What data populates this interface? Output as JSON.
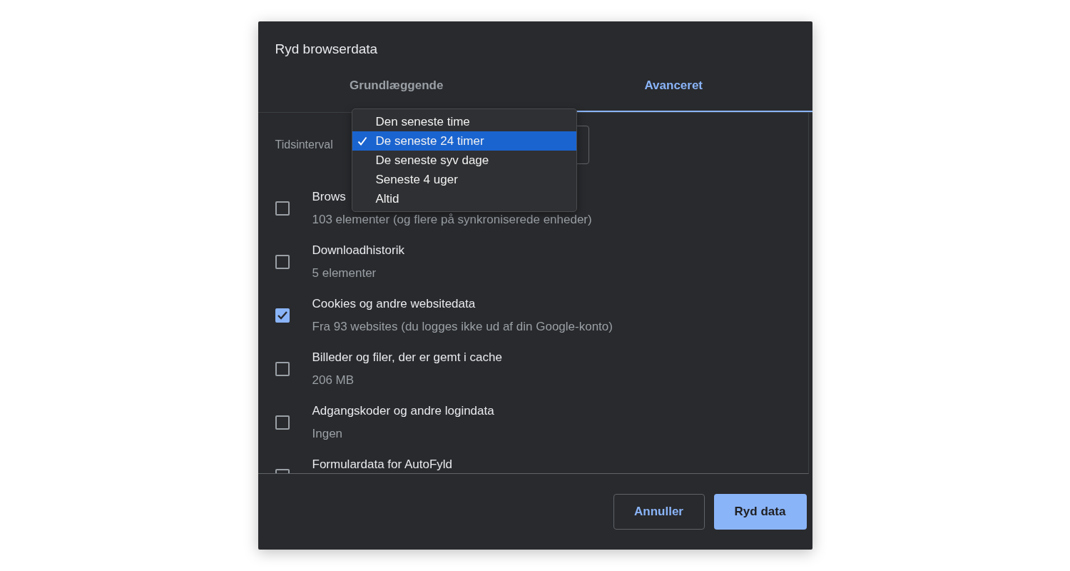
{
  "dialog": {
    "title": "Ryd browserdata",
    "tabs": [
      {
        "label": "Grundlæggende",
        "selected": false
      },
      {
        "label": "Avanceret",
        "selected": true
      }
    ],
    "time_range": {
      "label": "Tidsinterval",
      "menu": [
        {
          "label": "Den seneste time",
          "selected": false
        },
        {
          "label": "De seneste 24 timer",
          "selected": true
        },
        {
          "label": "De seneste syv dage",
          "selected": false
        },
        {
          "label": "Seneste 4 uger",
          "selected": false
        },
        {
          "label": "Altid",
          "selected": false
        }
      ]
    },
    "items": [
      {
        "title": "Brows",
        "detail": "103 elementer (og flere på synkroniserede enheder)",
        "checked": false
      },
      {
        "title": "Downloadhistorik",
        "detail": "5 elementer",
        "checked": false
      },
      {
        "title": "Cookies og andre websitedata",
        "detail": "Fra 93 websites (du logges ikke ud af din Google-konto)",
        "checked": true
      },
      {
        "title": "Billeder og filer, der er gemt i cache",
        "detail": "206 MB",
        "checked": false
      },
      {
        "title": "Adgangskoder og andre logindata",
        "detail": "Ingen",
        "checked": false
      },
      {
        "title": "Formulardata for AutoFyld",
        "checked": false
      }
    ],
    "buttons": [
      {
        "label": "Annuller",
        "kind": "secondary"
      },
      {
        "label": "Ryd data",
        "kind": "primary"
      }
    ]
  }
}
